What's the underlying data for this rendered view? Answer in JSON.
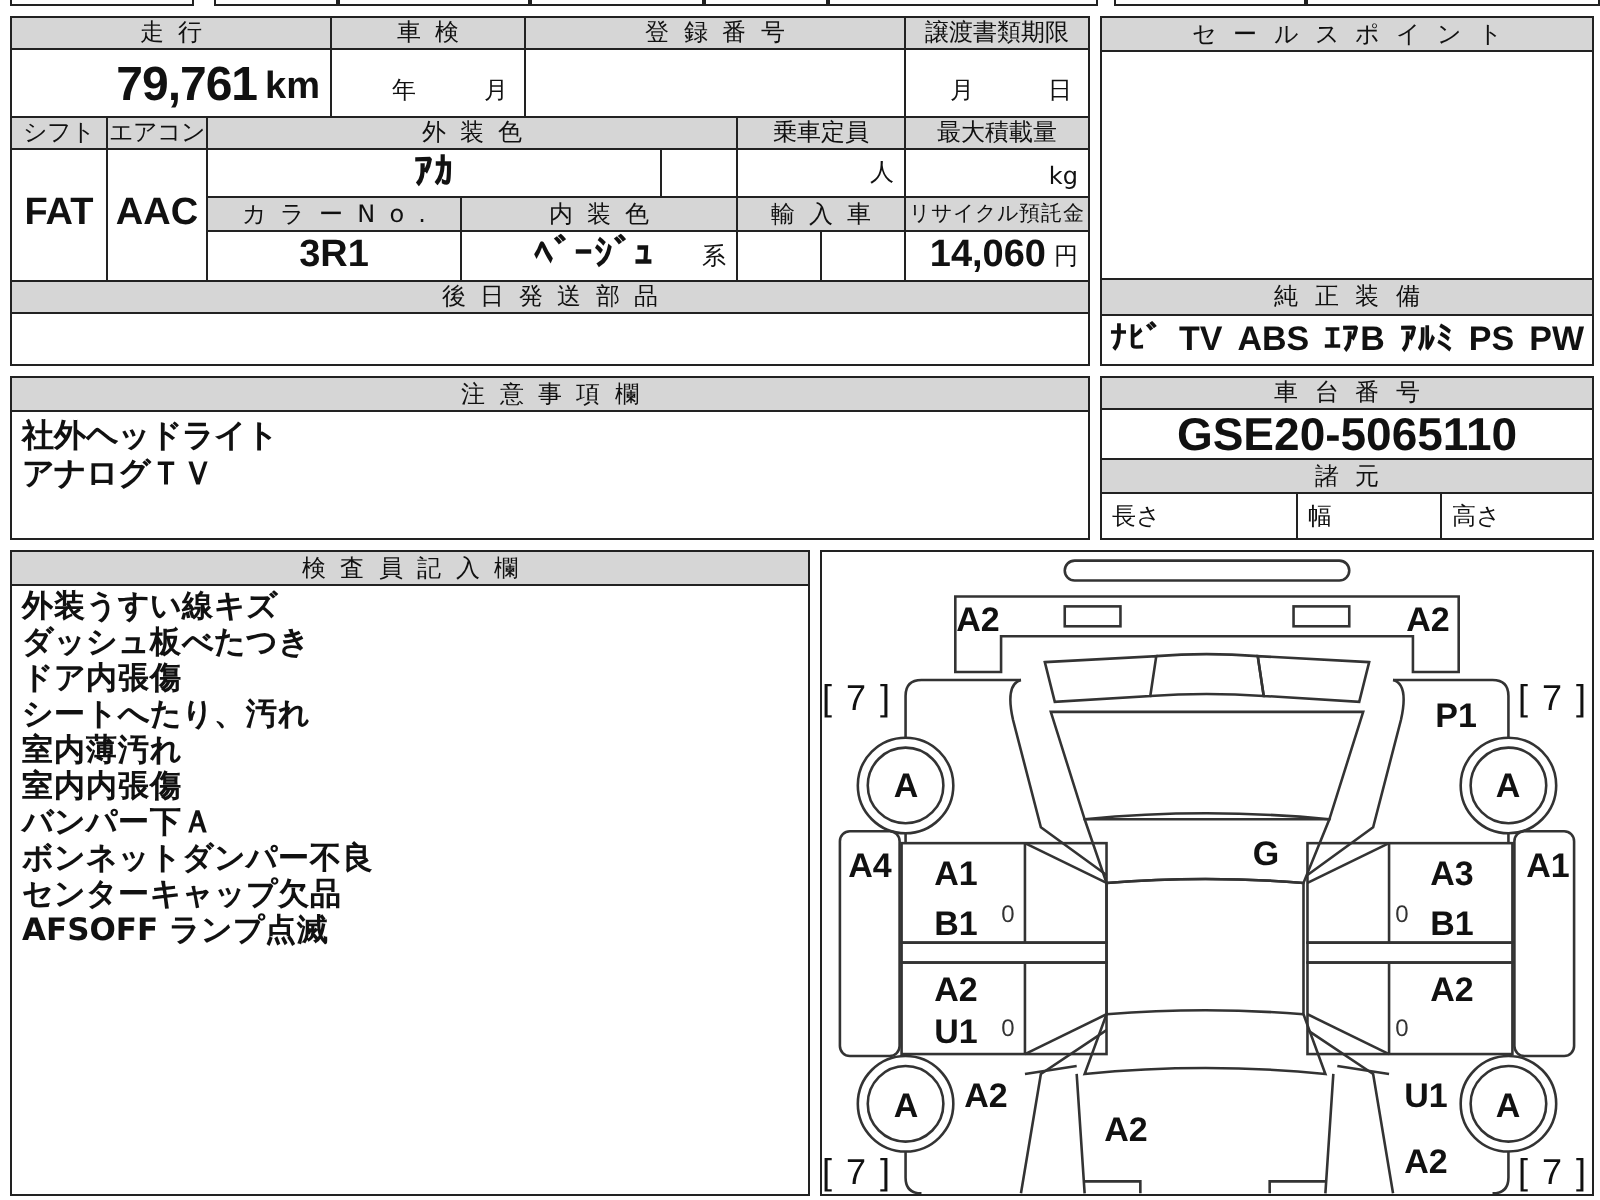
{
  "vehicle_table": {
    "mileage": {
      "label": "走行",
      "value": "79,761",
      "unit": "km"
    },
    "inspection": {
      "label": "車検",
      "year_unit": "年",
      "month_unit": "月"
    },
    "registration_number": {
      "label": "登録番号"
    },
    "transfer_deadline": {
      "label": "譲渡書類期限",
      "month_unit": "月",
      "day_unit": "日"
    },
    "shift": {
      "label": "シフト",
      "value": "FAT"
    },
    "air_conditioner": {
      "label": "エアコン",
      "value": "AAC"
    },
    "exterior_color": {
      "label": "外装色",
      "value": "ｱｶ"
    },
    "capacity": {
      "label": "乗車定員",
      "unit": "人"
    },
    "max_load": {
      "label": "最大積載量",
      "unit": "kg"
    },
    "color_no": {
      "label": "カラーNo.",
      "value": "3R1"
    },
    "interior_color": {
      "label": "内装色",
      "value": "ﾍﾞｰｼﾞｭ",
      "suffix": "系"
    },
    "imported": {
      "label": "輸入車"
    },
    "recycling_fee": {
      "label": "リサイクル預託金",
      "value": "14,060",
      "unit": "円"
    },
    "later_parts": {
      "label": "後日発送部品"
    }
  },
  "sales_point": {
    "label": "セールスポイント"
  },
  "genuine_equipment": {
    "label": "純正装備",
    "items": [
      "ﾅﾋﾞ",
      "TV",
      "ABS",
      "ｴｱB",
      "ｱﾙﾐ",
      "PS",
      "PW"
    ]
  },
  "notes": {
    "label": "注意事項欄",
    "lines": [
      "社外ヘッドライト",
      "アナログＴＶ"
    ]
  },
  "chassis": {
    "label": "車台番号",
    "value": "GSE20-5065110",
    "specs_label": "諸元",
    "specs": [
      "長さ",
      "幅",
      "高さ"
    ]
  },
  "inspector_notes": {
    "label": "検査員記入欄",
    "lines": [
      "外装うすい線キズ",
      "ダッシュ板べたつき",
      "ドア内張傷",
      "シートへたり、汚れ",
      "室内薄汚れ",
      "室内内張傷",
      "バンパー下Ａ",
      "ボンネットダンパー不良",
      "センターキャップ欠品",
      "AFSOFF ランプ点滅"
    ]
  },
  "car_diagram": {
    "marks": [
      {
        "kind": "damage",
        "text": "A2"
      },
      {
        "kind": "damage",
        "text": "A2"
      },
      {
        "kind": "bracket",
        "text": "[ 7 ]"
      },
      {
        "kind": "damage",
        "text": "P1"
      },
      {
        "kind": "bracket",
        "text": "[ 7 ]"
      },
      {
        "kind": "damage",
        "text": "A"
      },
      {
        "kind": "damage",
        "text": "A"
      },
      {
        "kind": "damage",
        "text": "A4"
      },
      {
        "kind": "damage",
        "text": "A1"
      },
      {
        "kind": "damage",
        "text": "G"
      },
      {
        "kind": "damage",
        "text": "A3"
      },
      {
        "kind": "damage",
        "text": "A1"
      },
      {
        "kind": "damage",
        "text": "B1"
      },
      {
        "kind": "minor",
        "text": "0"
      },
      {
        "kind": "minor",
        "text": "0"
      },
      {
        "kind": "damage",
        "text": "B1"
      },
      {
        "kind": "damage",
        "text": "A2"
      },
      {
        "kind": "damage",
        "text": "A2"
      },
      {
        "kind": "damage",
        "text": "U1"
      },
      {
        "kind": "minor",
        "text": "0"
      },
      {
        "kind": "minor",
        "text": "0"
      },
      {
        "kind": "damage",
        "text": "A"
      },
      {
        "kind": "damage",
        "text": "A2"
      },
      {
        "kind": "damage",
        "text": "U1"
      },
      {
        "kind": "damage",
        "text": "A"
      },
      {
        "kind": "damage",
        "text": "A2"
      },
      {
        "kind": "bracket",
        "text": "[ 7 ]"
      },
      {
        "kind": "damage",
        "text": "A2"
      },
      {
        "kind": "bracket",
        "text": "[ 7 ]"
      }
    ]
  }
}
